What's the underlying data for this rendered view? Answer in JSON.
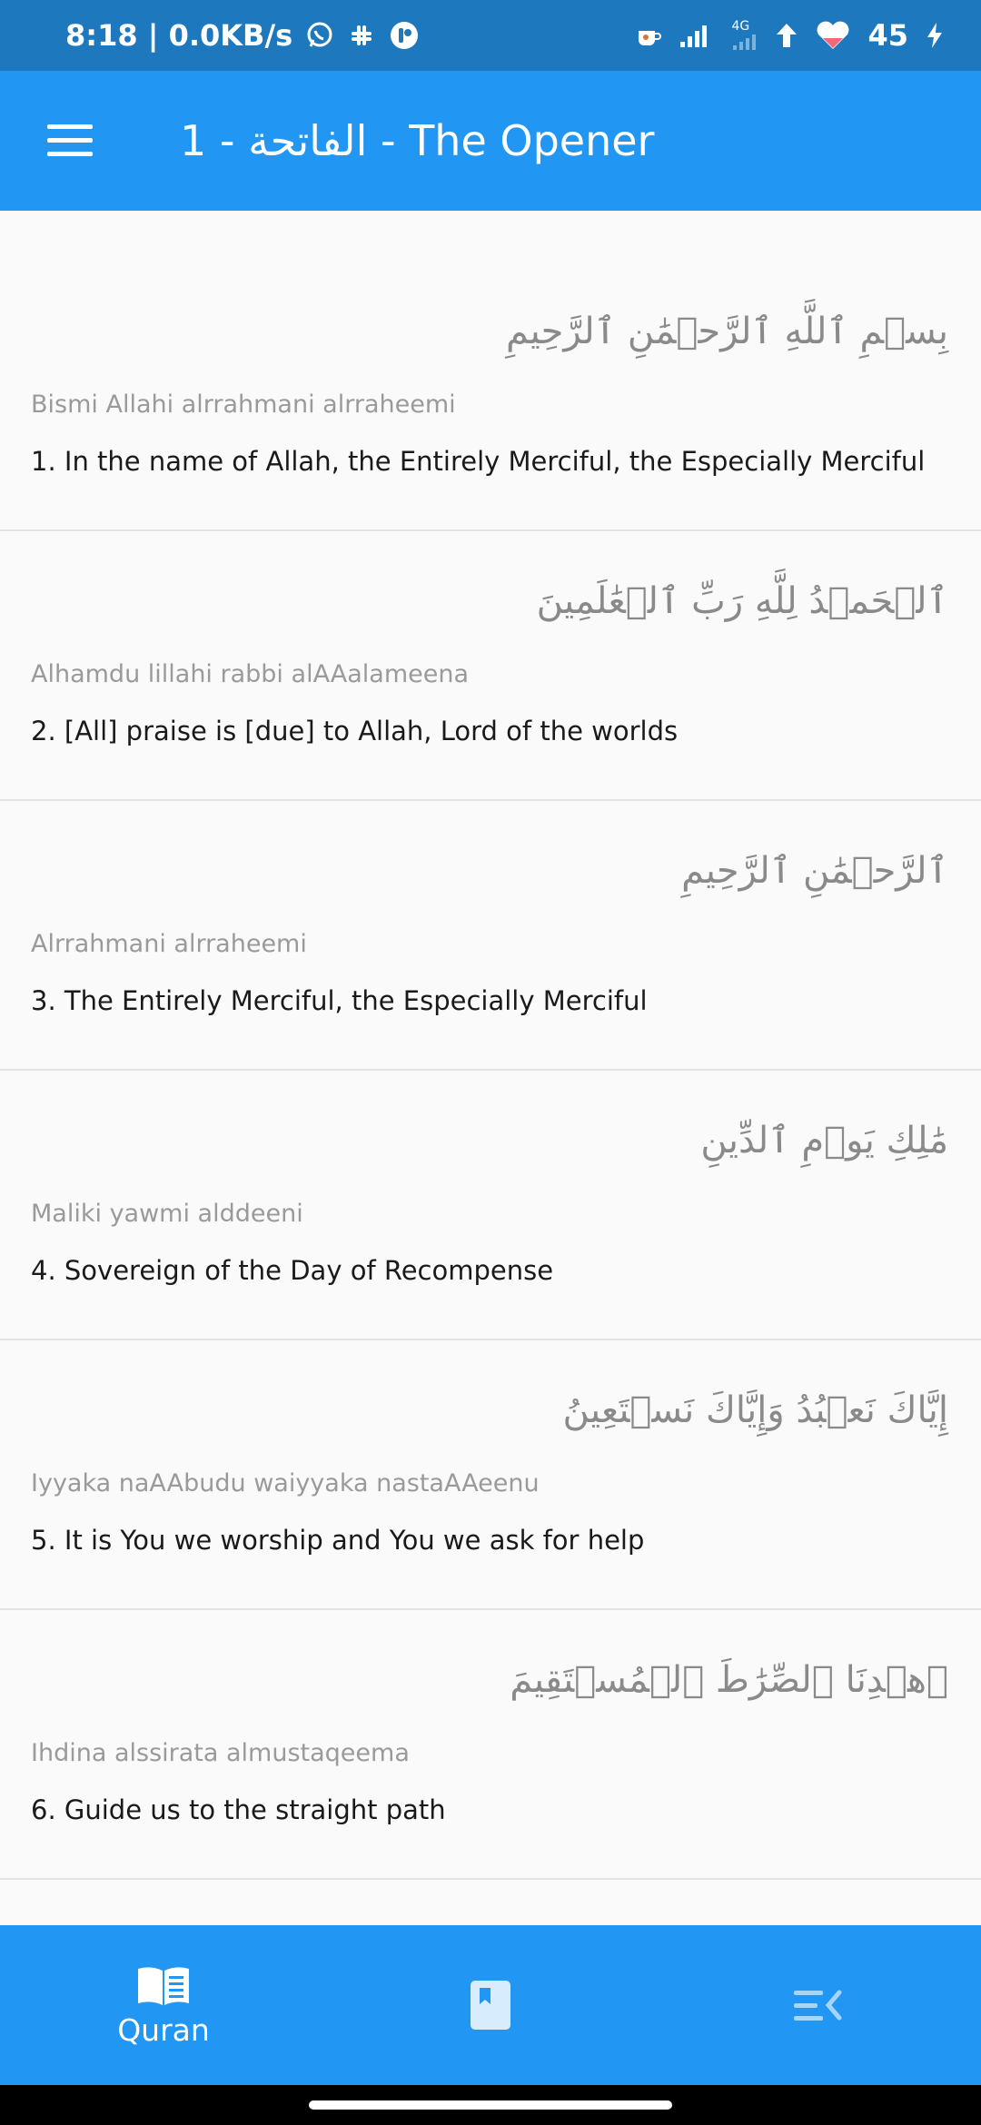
{
  "status_bar": {
    "time_speed": "8:18 | 0.0KB/s",
    "network": "4G",
    "battery": "45"
  },
  "app_bar": {
    "title": "1  -  الفاتحة  -  The Opener"
  },
  "verses": [
    {
      "arabic": "بِسۡمِ ٱللَّهِ ٱلرَّحۡمَٰنِ ٱلرَّحِيمِ",
      "transliteration": "Bismi Allahi alrrahmani alrraheemi",
      "translation": "1. In the name of Allah, the Entirely Merciful, the Especially Merciful"
    },
    {
      "arabic": "ٱلۡحَمۡدُ لِلَّهِ رَبِّ ٱلۡعَٰلَمِينَ",
      "transliteration": "Alhamdu lillahi rabbi alAAalameena",
      "translation": "2. [All] praise is [due] to Allah, Lord of the worlds"
    },
    {
      "arabic": "ٱلرَّحۡمَٰنِ ٱلرَّحِيمِ",
      "transliteration": "Alrrahmani alrraheemi",
      "translation": "3. The Entirely Merciful, the Especially Merciful"
    },
    {
      "arabic": "مَٰلِكِ يَوۡمِ ٱلدِّينِ",
      "transliteration": "Maliki yawmi alddeeni",
      "translation": "4. Sovereign of the Day of Recompense"
    },
    {
      "arabic": "إِيَّاكَ نَعۡبُدُ وَإِيَّاكَ نَسۡتَعِينُ",
      "transliteration": "Iyyaka naAAbudu waiyyaka nastaAAeenu",
      "translation": "5. It is You we worship and You we ask for help"
    },
    {
      "arabic": "ٱهۡدِنَا ٱلصِّرَٰطَ ٱلۡمُسۡتَقِيمَ",
      "transliteration": "Ihdina alssirata almustaqeema",
      "translation": "6. Guide us to the straight path"
    }
  ],
  "bottom_nav": {
    "items": [
      {
        "label": "Quran",
        "icon": "open-book-icon",
        "active": true
      },
      {
        "label": "",
        "icon": "bookmark-icon",
        "active": false
      },
      {
        "label": "",
        "icon": "menu-collapse-icon",
        "active": false
      }
    ]
  },
  "colors": {
    "app_bar": "#2196f3",
    "status_bar": "#1e78bd",
    "background": "#fafafa"
  }
}
